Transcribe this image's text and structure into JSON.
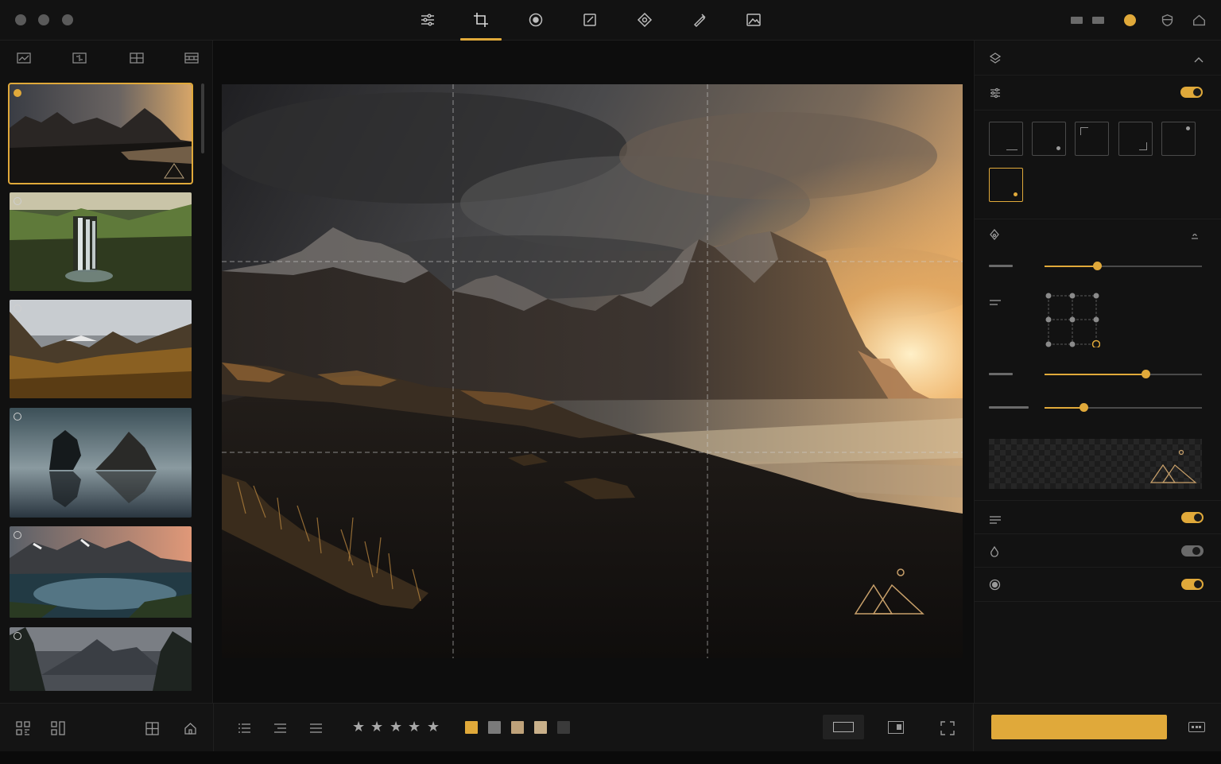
{
  "window": {
    "traffic_lights": [
      "close",
      "minimize",
      "maximize"
    ]
  },
  "toolbar": {
    "tools": [
      {
        "name": "adjustments",
        "icon": "sliders-icon",
        "active": false
      },
      {
        "name": "crop",
        "icon": "crop-icon",
        "active": true
      },
      {
        "name": "radial",
        "icon": "radial-icon",
        "active": false
      },
      {
        "name": "edit",
        "icon": "edit-icon",
        "active": false
      },
      {
        "name": "heal",
        "icon": "heal-icon",
        "active": false
      },
      {
        "name": "brush",
        "icon": "brush-icon",
        "active": false
      },
      {
        "name": "image",
        "icon": "image-icon",
        "active": false
      }
    ],
    "right_icons": [
      "panel-left-icon",
      "panel-right-icon",
      "accent-dot-icon",
      "shield-icon",
      "home-icon"
    ]
  },
  "sidebar": {
    "tabs": [
      "gallery-icon",
      "compare-icon",
      "grid-icon",
      "filmstrip-icon"
    ],
    "thumbnails": [
      {
        "scene": "mountain-sunset-beach",
        "selected": true
      },
      {
        "scene": "waterfall-green-valley",
        "selected": false
      },
      {
        "scene": "golden-valley",
        "selected": false
      },
      {
        "scene": "sea-stacks-reflection",
        "selected": false
      },
      {
        "scene": "mountain-lake-dusk",
        "selected": false
      },
      {
        "scene": "misty-forest-peaks",
        "selected": false
      }
    ]
  },
  "inspector": {
    "sections": [
      {
        "icon": "layers-icon",
        "collapse_icon": "chevron-up-icon"
      },
      {
        "icon": "sliders-icon",
        "toggle": true
      }
    ],
    "presets_count": 6,
    "active_preset": 5,
    "sliders": [
      {
        "value": 0.33
      },
      {
        "value": 0.64
      },
      {
        "value": 0.25
      }
    ],
    "toggles": [
      {
        "icon": "list-icon",
        "on": true
      },
      {
        "icon": "drop-icon",
        "on": false
      },
      {
        "icon": "target-icon",
        "on": true
      }
    ]
  },
  "bottom": {
    "left_icons": [
      "qr-icon",
      "qr-alt-icon",
      "grid-icon",
      "home-icon"
    ],
    "view_icons": [
      "list-icon",
      "list-indent-icon",
      "menu-icon"
    ],
    "rating": {
      "stars": 5
    },
    "color_labels": [
      "#e0a93a",
      "#7a7a7a",
      "#bfa27a",
      "#c9b08a",
      "#3a3a3a"
    ],
    "display_icons": [
      "single-view-icon",
      "split-view-icon",
      "fullscreen-icon"
    ],
    "more_icon": "more-icon"
  },
  "colors": {
    "accent": "#e0a93a",
    "background": "#0c0c0c",
    "panel": "#121212"
  }
}
